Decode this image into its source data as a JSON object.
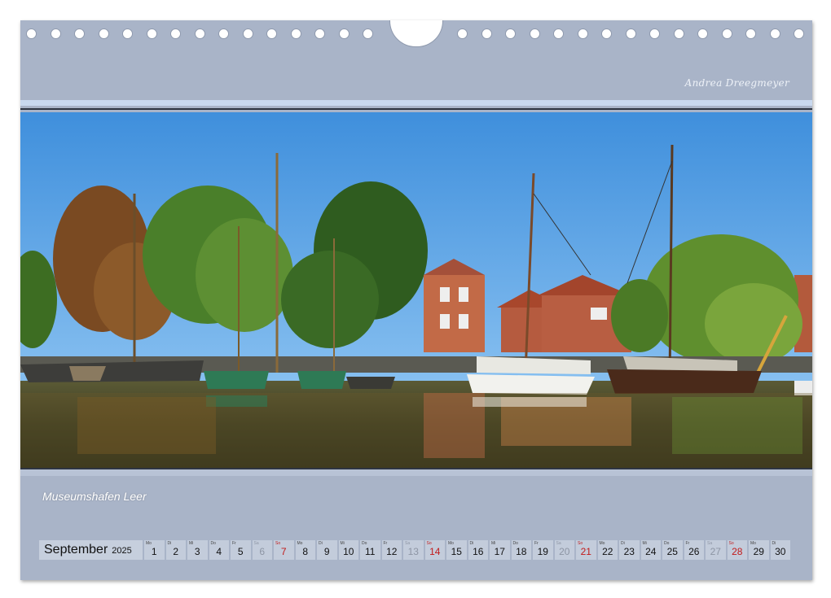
{
  "calendar_page": {
    "signature": "Andrea Dreegmeyer",
    "caption": "Museumshafen Leer",
    "month": "September",
    "year": "2025",
    "colors": {
      "sheet": "#a9b4c8",
      "sunday": "#c21a1a",
      "saturday": "#8d95a4",
      "stripe": "#c9d9ef"
    },
    "days": [
      {
        "wd": "Mo",
        "d": "1",
        "type": "weekday"
      },
      {
        "wd": "Di",
        "d": "2",
        "type": "weekday"
      },
      {
        "wd": "Mi",
        "d": "3",
        "type": "weekday"
      },
      {
        "wd": "Do",
        "d": "4",
        "type": "weekday"
      },
      {
        "wd": "Fr",
        "d": "5",
        "type": "weekday"
      },
      {
        "wd": "Sa",
        "d": "6",
        "type": "sat"
      },
      {
        "wd": "So",
        "d": "7",
        "type": "sun"
      },
      {
        "wd": "Mo",
        "d": "8",
        "type": "weekday"
      },
      {
        "wd": "Di",
        "d": "9",
        "type": "weekday"
      },
      {
        "wd": "Mi",
        "d": "10",
        "type": "weekday"
      },
      {
        "wd": "Do",
        "d": "11",
        "type": "weekday"
      },
      {
        "wd": "Fr",
        "d": "12",
        "type": "weekday"
      },
      {
        "wd": "Sa",
        "d": "13",
        "type": "sat"
      },
      {
        "wd": "So",
        "d": "14",
        "type": "sun"
      },
      {
        "wd": "Mo",
        "d": "15",
        "type": "weekday"
      },
      {
        "wd": "Di",
        "d": "16",
        "type": "weekday"
      },
      {
        "wd": "Mi",
        "d": "17",
        "type": "weekday"
      },
      {
        "wd": "Do",
        "d": "18",
        "type": "weekday"
      },
      {
        "wd": "Fr",
        "d": "19",
        "type": "weekday"
      },
      {
        "wd": "Sa",
        "d": "20",
        "type": "sat"
      },
      {
        "wd": "So",
        "d": "21",
        "type": "sun"
      },
      {
        "wd": "Mo",
        "d": "22",
        "type": "weekday"
      },
      {
        "wd": "Di",
        "d": "23",
        "type": "weekday"
      },
      {
        "wd": "Mi",
        "d": "24",
        "type": "weekday"
      },
      {
        "wd": "Do",
        "d": "25",
        "type": "weekday"
      },
      {
        "wd": "Fr",
        "d": "26",
        "type": "weekday"
      },
      {
        "wd": "Sa",
        "d": "27",
        "type": "sat"
      },
      {
        "wd": "So",
        "d": "28",
        "type": "sun"
      },
      {
        "wd": "Mo",
        "d": "29",
        "type": "weekday"
      },
      {
        "wd": "Di",
        "d": "30",
        "type": "weekday"
      }
    ]
  }
}
